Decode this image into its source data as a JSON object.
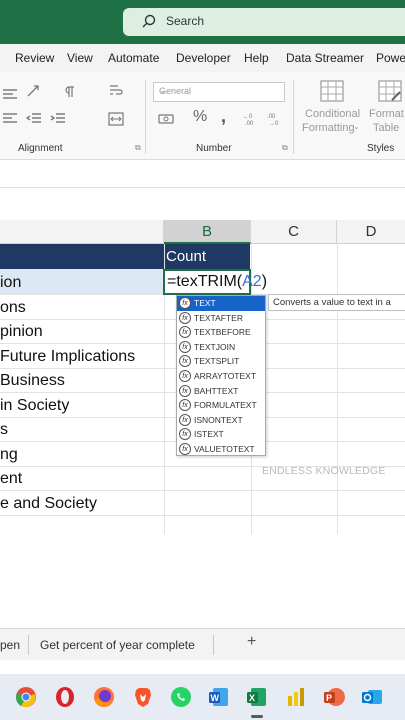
{
  "search": {
    "label": "Search"
  },
  "menu": [
    "Review",
    "View",
    "Automate",
    "Developer",
    "Help",
    "Data Streamer",
    "Power"
  ],
  "ribbon": {
    "number_format": "General",
    "conditional_formatting_1": "Conditional",
    "conditional_formatting_2": "Formatting",
    "format_table_1": "Format",
    "format_table_2": "Table",
    "group_alignment": "Alignment",
    "group_number": "Number",
    "group_styles": "Styles"
  },
  "columns": [
    "B",
    "C",
    "D"
  ],
  "header_cell": "Count",
  "rows": [
    "ion",
    "ons",
    "pinion",
    " Future Implications",
    " Business",
    " in Society",
    "s",
    "ng",
    "ent",
    "e and Society"
  ],
  "formula": {
    "prefix": "=texTRIM(",
    "ref": "A2",
    "suffix": ")"
  },
  "autocomplete": [
    "TEXT",
    "TEXTAFTER",
    "TEXTBEFORE",
    "TEXTJOIN",
    "TEXTSPLIT",
    "ARRAYTOTEXT",
    "BAHTTEXT",
    "FORMULATEXT",
    "ISNONTEXT",
    "ISTEXT",
    "VALUETOTEXT"
  ],
  "autocomplete_selected": 0,
  "tooltip": "Converts a value to text in a",
  "watermark": "ENDLESS KNOWLEDGE",
  "sheet_tabs": [
    "pen",
    "Get percent of year complete"
  ],
  "add_sheet": "+",
  "colors": {
    "excel_green": "#1e7145",
    "header_navy": "#1f3864",
    "selection": "#1764c9"
  }
}
